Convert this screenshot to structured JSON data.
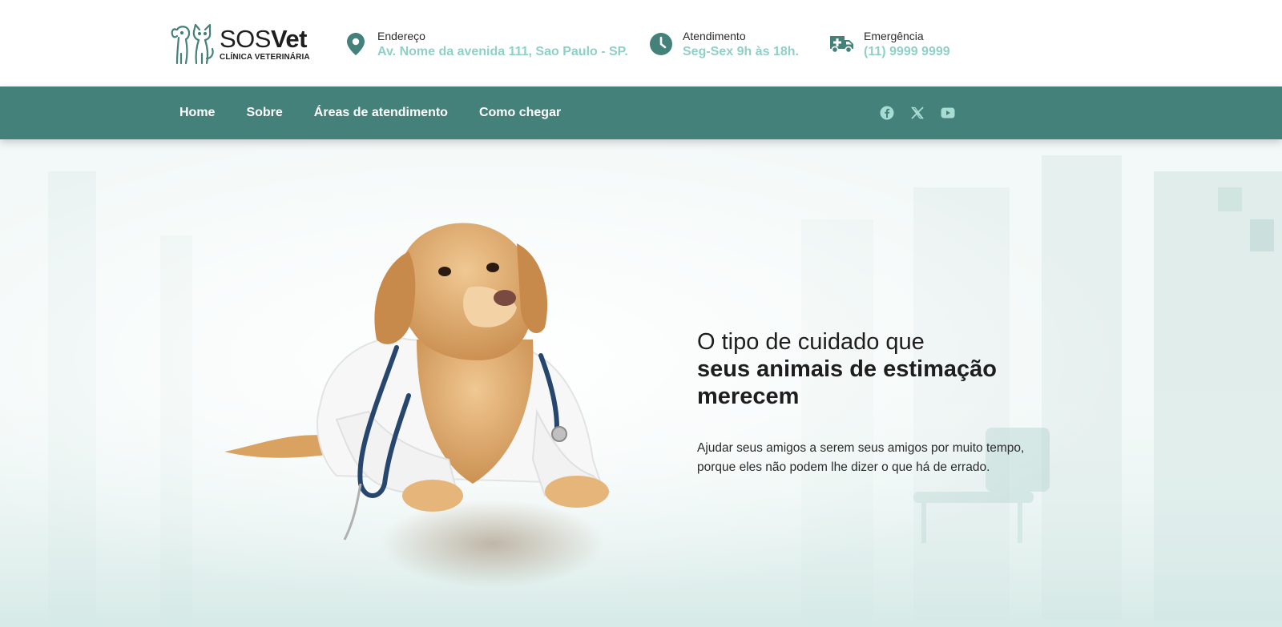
{
  "brand": {
    "name_light": "SOS",
    "name_bold": "Vet",
    "tagline": "CLÍNICA VETERINÁRIA",
    "accent_color": "#45817b",
    "highlight_color": "#8fd0c6"
  },
  "contact": {
    "address": {
      "label": "Endereço",
      "value": "Av. Nome da avenida 111, Sao Paulo - SP.",
      "icon": "map-pin-icon"
    },
    "hours": {
      "label": "Atendimento",
      "value": "Seg-Sex 9h às 18h.",
      "icon": "clock-icon"
    },
    "emergency": {
      "label": "Emergência",
      "value": "(11) 9999 9999",
      "icon": "ambulance-icon"
    }
  },
  "nav": {
    "items": [
      {
        "label": "Home"
      },
      {
        "label": "Sobre"
      },
      {
        "label": "Áreas de atendimento"
      },
      {
        "label": "Como chegar"
      }
    ]
  },
  "social": [
    "facebook-icon",
    "x-icon",
    "youtube-icon"
  ],
  "hero": {
    "title_line1": "O tipo de cuidado que",
    "title_line2": "seus animais de estimação merecem",
    "subtitle": "Ajudar seus amigos a serem seus amigos por muito tempo, porque eles não podem lhe dizer o que há de errado."
  }
}
